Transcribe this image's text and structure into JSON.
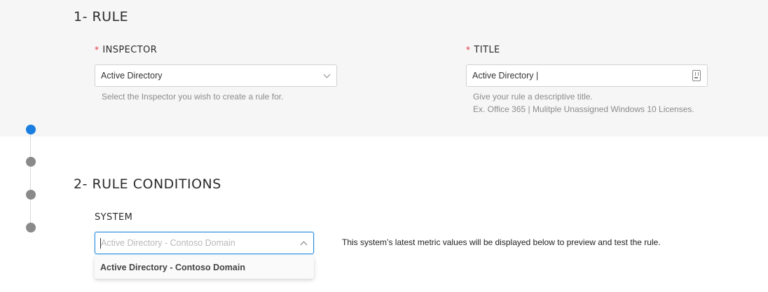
{
  "rule_section": {
    "heading": "1- RULE",
    "inspector": {
      "required_mark": "*",
      "label": "INSPECTOR",
      "selected_value": "Active Directory",
      "help": "Select the Inspector you wish to create a rule for."
    },
    "title": {
      "required_mark": "*",
      "label": "TITLE",
      "value": "Active Directory |",
      "help_line1": "Give your rule a descriptive title.",
      "help_line2": "Ex. Office 365 | Mulitple Unassigned Windows 10 Licenses."
    }
  },
  "conditions_section": {
    "heading": "2- RULE CONDITIONS",
    "system": {
      "label": "SYSTEM",
      "placeholder": "Active Directory - Contoso Domain",
      "info": "This system’s latest metric values will be displayed below to preview and test the rule.",
      "options": [
        "Active Directory - Contoso Domain"
      ]
    }
  },
  "stepper": {
    "active_step": 1,
    "steps": 4
  },
  "colors": {
    "accent": "#1a7ee0",
    "required": "#e0383e",
    "focus_border": "#2f8fde"
  }
}
